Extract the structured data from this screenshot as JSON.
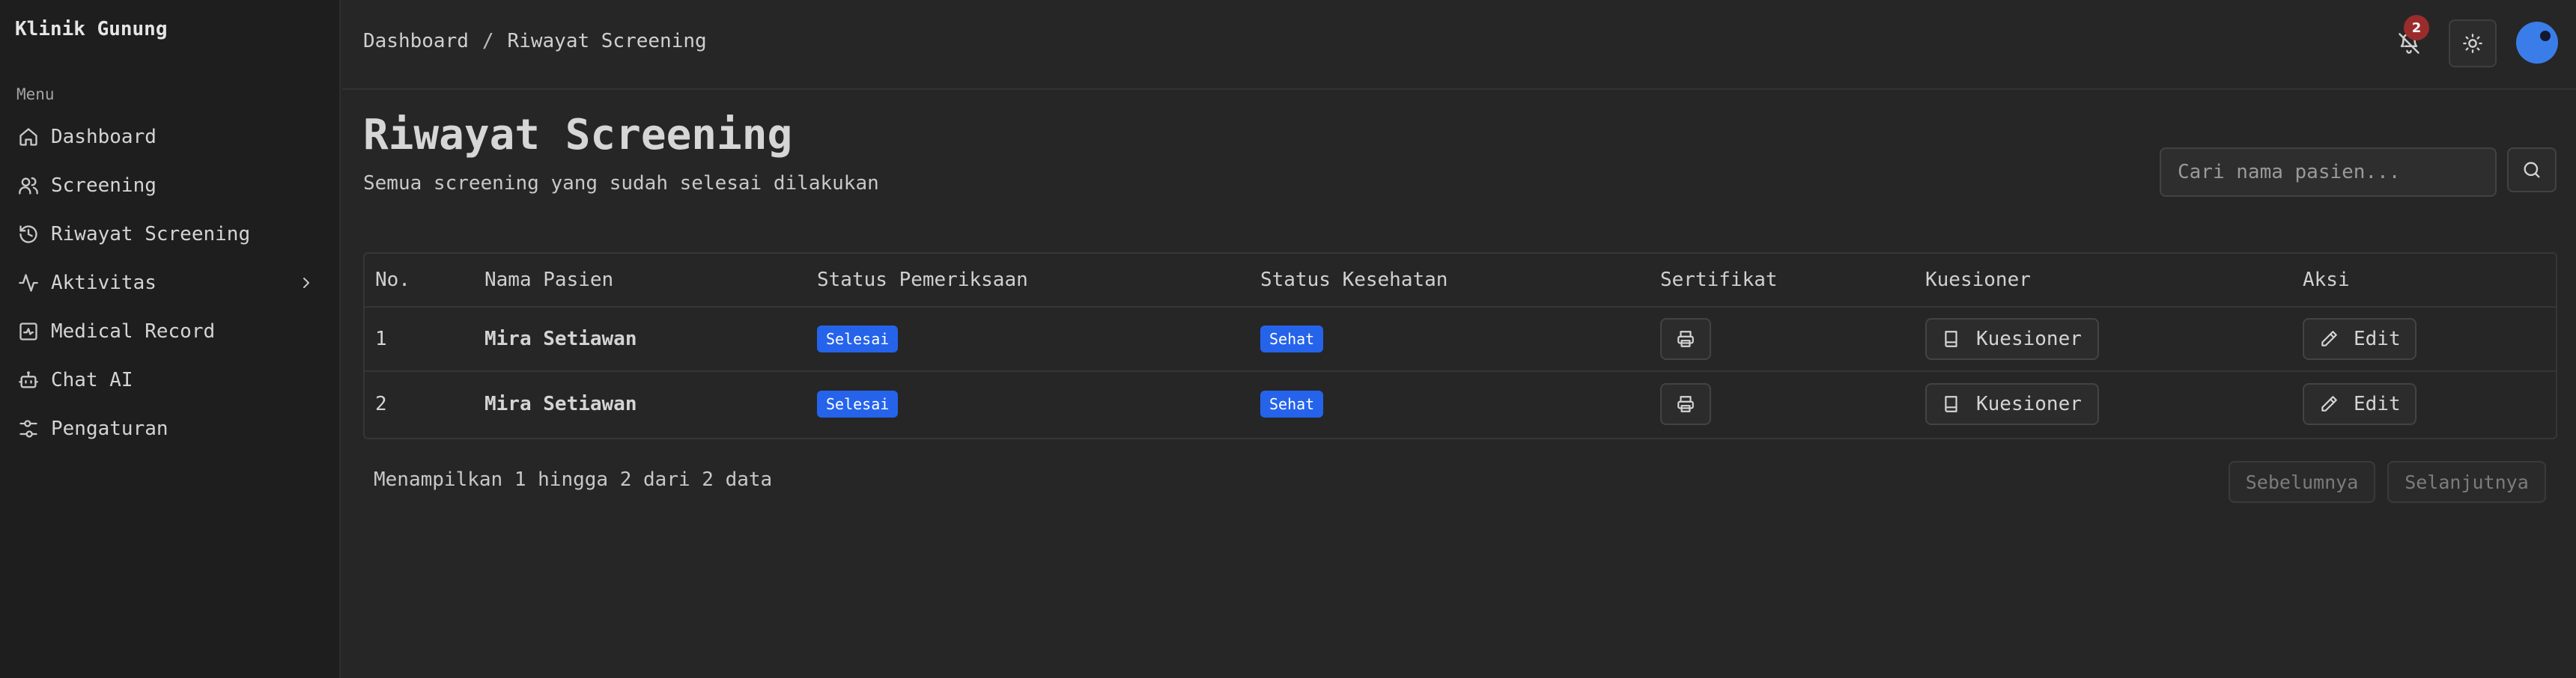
{
  "app": {
    "brand": "Klinik Gunung"
  },
  "sidebar": {
    "menu_label": "Menu",
    "items": [
      {
        "label": "Dashboard",
        "icon": "home-icon"
      },
      {
        "label": "Screening",
        "icon": "users-icon"
      },
      {
        "label": "Riwayat Screening",
        "icon": "history-icon"
      },
      {
        "label": "Aktivitas",
        "icon": "activity-icon",
        "has_submenu": true
      },
      {
        "label": "Medical Record",
        "icon": "medical-record-icon"
      },
      {
        "label": "Chat AI",
        "icon": "bot-icon"
      },
      {
        "label": "Pengaturan",
        "icon": "settings-sliders-icon"
      }
    ]
  },
  "header": {
    "breadcrumb": {
      "root": "Dashboard",
      "separator": "/",
      "current": "Riwayat Screening"
    },
    "notification_count": "2",
    "avatar_color": "#3b7de8"
  },
  "main": {
    "title": "Riwayat Screening",
    "subtitle": "Semua screening yang sudah selesai dilakukan",
    "search": {
      "placeholder": "Cari nama pasien...",
      "value": ""
    }
  },
  "table": {
    "columns": {
      "no": "No.",
      "name": "Nama Pasien",
      "exam_status": "Status Pemeriksaan",
      "health_status": "Status Kesehatan",
      "certificate": "Sertifikat",
      "questionnaire": "Kuesioner",
      "action": "Aksi"
    },
    "rows": [
      {
        "no": "1",
        "name": "Mira Setiawan",
        "exam_status": "Selesai",
        "health_status": "Sehat",
        "questionnaire_label": "Kuesioner",
        "action_label": "Edit"
      },
      {
        "no": "2",
        "name": "Mira Setiawan",
        "exam_status": "Selesai",
        "health_status": "Sehat",
        "questionnaire_label": "Kuesioner",
        "action_label": "Edit"
      }
    ]
  },
  "pagination": {
    "summary": "Menampilkan 1 hingga 2 dari 2 data",
    "prev_label": "Sebelumnya",
    "next_label": "Selanjutnya"
  },
  "colors": {
    "accent": "#2563eb",
    "badge": "#9b2c2c",
    "background": "#262626",
    "sidebar": "#1e1e1e"
  }
}
